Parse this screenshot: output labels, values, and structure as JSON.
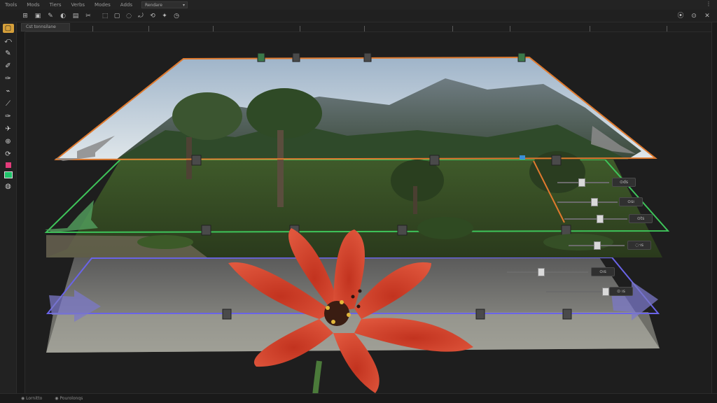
{
  "menubar": {
    "items": [
      "Tools",
      "Mods",
      "Tiers",
      "Verbs",
      "Modes",
      "Adds"
    ],
    "document_select": "Rendare",
    "right_icon": "⋮"
  },
  "toolbar": {
    "left_icons": [
      "⊞",
      "▣",
      "✎",
      "◐",
      "▤",
      "✂"
    ],
    "mid_icons": [
      "⬚",
      "▢",
      "◌",
      "⤾",
      "⟲",
      "✦",
      "◷"
    ],
    "right_icons": [
      "⦿",
      "⊙",
      "✕"
    ]
  },
  "document_tab": "Cst  tonnsilane",
  "tools": [
    "▢",
    "⤺",
    "✎",
    "✐",
    "✑",
    "⌁",
    "⟋",
    "✑",
    "✈",
    "⊕",
    "⟳",
    "◍"
  ],
  "layers": {
    "top_color": "#e07a2e",
    "middle_color": "#3ec45a",
    "bottom_color": "#6a64e8"
  },
  "sliders": [
    {
      "value_label": "⊙ds"
    },
    {
      "value_label": "⊙sı"
    },
    {
      "value_label": "⊙ts"
    },
    {
      "value_label": "◌·ıs"
    },
    {
      "value_label": "⊙ıs"
    },
    {
      "value_label": "⊙ ıs"
    }
  ],
  "statusbar": {
    "left": "◉  Lornitto",
    "right": "◉  Pourolonqs"
  }
}
